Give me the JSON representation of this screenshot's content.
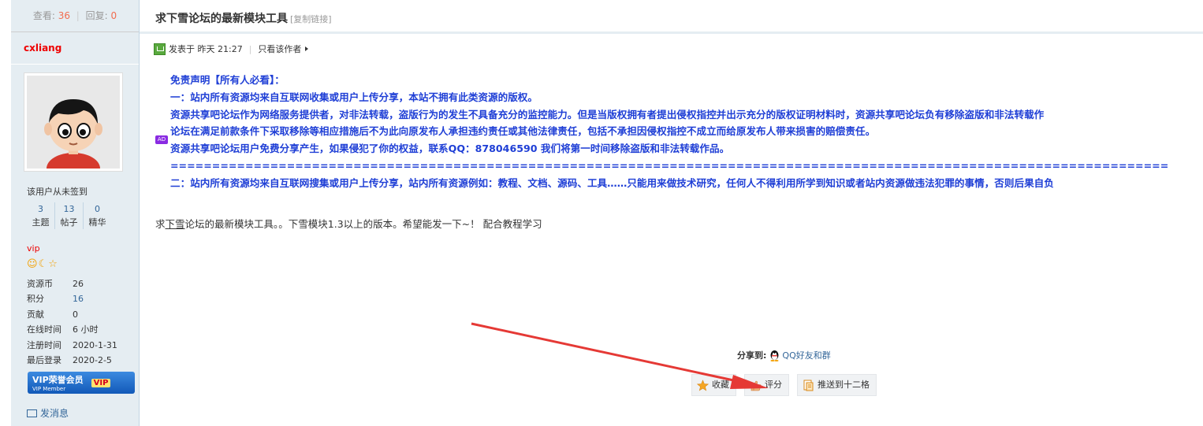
{
  "sidebar": {
    "views_label": "查看:",
    "views": "36",
    "sep": "|",
    "replies_label": "回复:",
    "replies": "0",
    "author": "cxliang",
    "signin": "该用户从未签到",
    "counts": [
      {
        "value": "3",
        "label": "主题"
      },
      {
        "value": "13",
        "label": "帖子"
      },
      {
        "value": "0",
        "label": "精华"
      }
    ],
    "group": "vip",
    "info": [
      {
        "k": "资源币",
        "v": "26",
        "blue": false
      },
      {
        "k": "积分",
        "v": "16",
        "blue": true
      },
      {
        "k": "贡献",
        "v": "0",
        "blue": false
      },
      {
        "k": "在线时间",
        "v": "6 小时",
        "blue": false
      },
      {
        "k": "注册时间",
        "v": "2020-1-31",
        "blue": false
      },
      {
        "k": "最后登录",
        "v": "2020-2-5",
        "blue": false
      }
    ],
    "vip_badge": "VIP荣誉会员",
    "vip_badge_sub": "VIP Member",
    "vip_tag": "VIP",
    "send_message": "发消息"
  },
  "post": {
    "title": "求下雪论坛的最新模块工具",
    "copy_link": "[复制链接]",
    "posted_label": "发表于 昨天 21:27",
    "only_author": "只看该作者",
    "ad_badge": "AD",
    "disclaimer": [
      "免责声明【所有人必看】：",
      "一：站内所有资源均来自互联网收集或用户上传分享，本站不拥有此类资源的版权。",
      "资源共享吧论坛作为网络服务提供者，对非法转载，盗版行为的发生不具备充分的监控能力。但是当版权拥有者提出侵权指控并出示充分的版权证明材料时，资源共享吧论坛负有移除盗版和非法转载作",
      "论坛在满足前款条件下采取移除等相应措施后不为此向原发布人承担违约责任或其他法律责任，包括不承担因侵权指控不成立而给原发布人带来损害的赔偿责任。",
      "资源共享吧论坛用户免费分享产生，如果侵犯了你的权益，联系QQ：878046590 我们将第一时间移除盗版和非法转载作品。",
      "========================================================================================================================",
      "二：站内所有资源均来自互联网搜集或用户上传分享，站内所有资源例如：教程、文档、源码、工具……只能用来做技术研究，任何人不得利用所学到知识或者站内资源做违法犯罪的事情，否则后果自负"
    ],
    "body_pre": "求",
    "body_link": "下雪",
    "body_post": "论坛的最新模块工具。。下雪模块1.3以上的版本。希望能发一下~！ 配合教程学习",
    "share_label": "分享到:",
    "share_qq": "QQ好友和群",
    "buttons": {
      "favorite": "收藏",
      "rate": "评分",
      "push": "推送到十二格"
    }
  },
  "colors": {
    "accent_red": "#e53935",
    "link_blue": "#336699",
    "disclaimer_blue": "#1f3fd6"
  }
}
